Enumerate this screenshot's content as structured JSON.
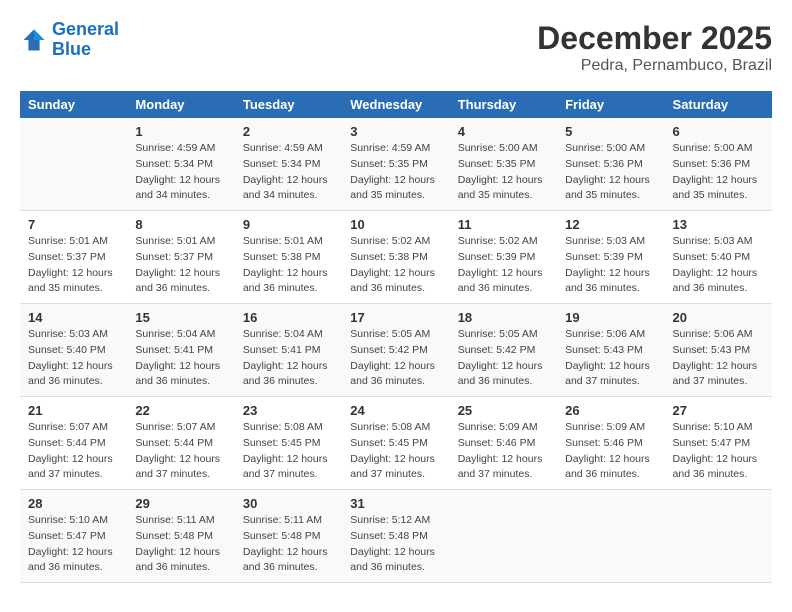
{
  "logo": {
    "line1": "General",
    "line2": "Blue"
  },
  "title": "December 2025",
  "subtitle": "Pedra, Pernambuco, Brazil",
  "weekdays": [
    "Sunday",
    "Monday",
    "Tuesday",
    "Wednesday",
    "Thursday",
    "Friday",
    "Saturday"
  ],
  "weeks": [
    [
      {
        "day": "",
        "info": ""
      },
      {
        "day": "1",
        "info": "Sunrise: 4:59 AM\nSunset: 5:34 PM\nDaylight: 12 hours\nand 34 minutes."
      },
      {
        "day": "2",
        "info": "Sunrise: 4:59 AM\nSunset: 5:34 PM\nDaylight: 12 hours\nand 34 minutes."
      },
      {
        "day": "3",
        "info": "Sunrise: 4:59 AM\nSunset: 5:35 PM\nDaylight: 12 hours\nand 35 minutes."
      },
      {
        "day": "4",
        "info": "Sunrise: 5:00 AM\nSunset: 5:35 PM\nDaylight: 12 hours\nand 35 minutes."
      },
      {
        "day": "5",
        "info": "Sunrise: 5:00 AM\nSunset: 5:36 PM\nDaylight: 12 hours\nand 35 minutes."
      },
      {
        "day": "6",
        "info": "Sunrise: 5:00 AM\nSunset: 5:36 PM\nDaylight: 12 hours\nand 35 minutes."
      }
    ],
    [
      {
        "day": "7",
        "info": "Sunrise: 5:01 AM\nSunset: 5:37 PM\nDaylight: 12 hours\nand 35 minutes."
      },
      {
        "day": "8",
        "info": "Sunrise: 5:01 AM\nSunset: 5:37 PM\nDaylight: 12 hours\nand 36 minutes."
      },
      {
        "day": "9",
        "info": "Sunrise: 5:01 AM\nSunset: 5:38 PM\nDaylight: 12 hours\nand 36 minutes."
      },
      {
        "day": "10",
        "info": "Sunrise: 5:02 AM\nSunset: 5:38 PM\nDaylight: 12 hours\nand 36 minutes."
      },
      {
        "day": "11",
        "info": "Sunrise: 5:02 AM\nSunset: 5:39 PM\nDaylight: 12 hours\nand 36 minutes."
      },
      {
        "day": "12",
        "info": "Sunrise: 5:03 AM\nSunset: 5:39 PM\nDaylight: 12 hours\nand 36 minutes."
      },
      {
        "day": "13",
        "info": "Sunrise: 5:03 AM\nSunset: 5:40 PM\nDaylight: 12 hours\nand 36 minutes."
      }
    ],
    [
      {
        "day": "14",
        "info": "Sunrise: 5:03 AM\nSunset: 5:40 PM\nDaylight: 12 hours\nand 36 minutes."
      },
      {
        "day": "15",
        "info": "Sunrise: 5:04 AM\nSunset: 5:41 PM\nDaylight: 12 hours\nand 36 minutes."
      },
      {
        "day": "16",
        "info": "Sunrise: 5:04 AM\nSunset: 5:41 PM\nDaylight: 12 hours\nand 36 minutes."
      },
      {
        "day": "17",
        "info": "Sunrise: 5:05 AM\nSunset: 5:42 PM\nDaylight: 12 hours\nand 36 minutes."
      },
      {
        "day": "18",
        "info": "Sunrise: 5:05 AM\nSunset: 5:42 PM\nDaylight: 12 hours\nand 36 minutes."
      },
      {
        "day": "19",
        "info": "Sunrise: 5:06 AM\nSunset: 5:43 PM\nDaylight: 12 hours\nand 37 minutes."
      },
      {
        "day": "20",
        "info": "Sunrise: 5:06 AM\nSunset: 5:43 PM\nDaylight: 12 hours\nand 37 minutes."
      }
    ],
    [
      {
        "day": "21",
        "info": "Sunrise: 5:07 AM\nSunset: 5:44 PM\nDaylight: 12 hours\nand 37 minutes."
      },
      {
        "day": "22",
        "info": "Sunrise: 5:07 AM\nSunset: 5:44 PM\nDaylight: 12 hours\nand 37 minutes."
      },
      {
        "day": "23",
        "info": "Sunrise: 5:08 AM\nSunset: 5:45 PM\nDaylight: 12 hours\nand 37 minutes."
      },
      {
        "day": "24",
        "info": "Sunrise: 5:08 AM\nSunset: 5:45 PM\nDaylight: 12 hours\nand 37 minutes."
      },
      {
        "day": "25",
        "info": "Sunrise: 5:09 AM\nSunset: 5:46 PM\nDaylight: 12 hours\nand 37 minutes."
      },
      {
        "day": "26",
        "info": "Sunrise: 5:09 AM\nSunset: 5:46 PM\nDaylight: 12 hours\nand 36 minutes."
      },
      {
        "day": "27",
        "info": "Sunrise: 5:10 AM\nSunset: 5:47 PM\nDaylight: 12 hours\nand 36 minutes."
      }
    ],
    [
      {
        "day": "28",
        "info": "Sunrise: 5:10 AM\nSunset: 5:47 PM\nDaylight: 12 hours\nand 36 minutes."
      },
      {
        "day": "29",
        "info": "Sunrise: 5:11 AM\nSunset: 5:48 PM\nDaylight: 12 hours\nand 36 minutes."
      },
      {
        "day": "30",
        "info": "Sunrise: 5:11 AM\nSunset: 5:48 PM\nDaylight: 12 hours\nand 36 minutes."
      },
      {
        "day": "31",
        "info": "Sunrise: 5:12 AM\nSunset: 5:48 PM\nDaylight: 12 hours\nand 36 minutes."
      },
      {
        "day": "",
        "info": ""
      },
      {
        "day": "",
        "info": ""
      },
      {
        "day": "",
        "info": ""
      }
    ]
  ]
}
